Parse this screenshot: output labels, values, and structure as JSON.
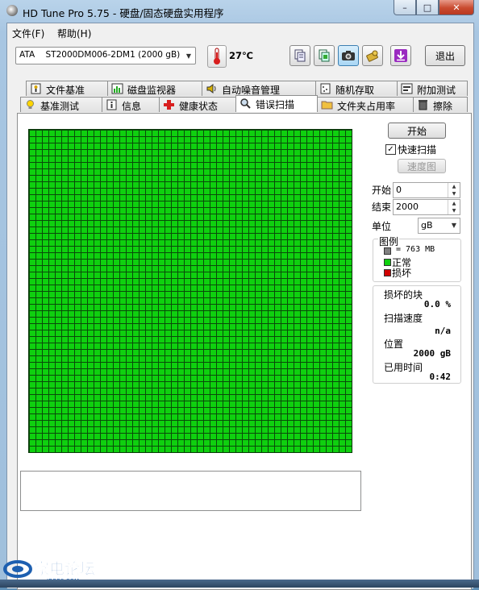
{
  "app": {
    "title": "HD Tune Pro 5.75 - 硬盘/固态硬盘实用程序"
  },
  "window_buttons": {
    "minimize": "–",
    "maximize": "□",
    "close": "✕"
  },
  "menu": {
    "file": "文件(F)",
    "help": "帮助(H)"
  },
  "toolbar": {
    "drive": "ATA    ST2000DM006-2DM1 (2000 gB)",
    "temperature": "27℃",
    "exit_label": "退出",
    "buttons": [
      "copy-text-icon",
      "copy-screenshot-icon",
      "camera-icon",
      "hdd-options-icon",
      "download-icon"
    ]
  },
  "tabs_row1": [
    "文件基准",
    "磁盘监视器",
    "自动噪音管理",
    "随机存取",
    "附加测试"
  ],
  "tabs_row2": [
    "基准测试",
    "信息",
    "健康状态",
    "错误扫描",
    "文件夹占用率",
    "擦除"
  ],
  "active_tab": "错误扫描",
  "scan": {
    "start_button": "开始",
    "quick_scan_label": "快速扫描",
    "quick_scan_checked": true,
    "speed_map_button": "速度图",
    "start_label": "开始",
    "start_value": "0",
    "end_label": "结束",
    "end_value": "2000",
    "unit_label": "单位",
    "unit_value": "gB",
    "legend_title": "图例",
    "legend_block": "= 763 MB",
    "legend_ok": "正常",
    "legend_bad": "损坏",
    "colors": {
      "ok": "#0fd00f",
      "bad": "#d00000",
      "block": "#808080"
    },
    "damaged_label": "损坏的块",
    "damaged_value": "0.0 %",
    "speed_label": "扫描速度",
    "speed_value": "n/a",
    "position_label": "位置",
    "position_value": "2000 gB",
    "elapsed_label": "已用时间",
    "elapsed_value": "0:42",
    "grid_state": "all blocks ok"
  },
  "watermark": {
    "text": "家电论坛",
    "sub": "JDBBS.COM"
  }
}
